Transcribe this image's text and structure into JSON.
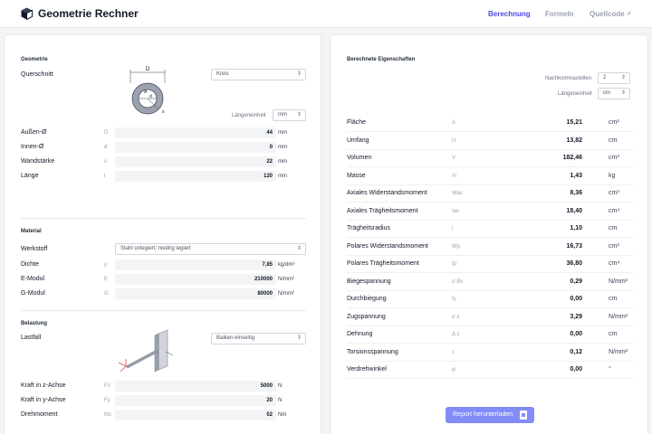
{
  "header": {
    "title": "Geometrie Rechner",
    "nav": {
      "calc": "Berechnung",
      "formulas": "Formeln",
      "source": "Quellcode"
    }
  },
  "geometry": {
    "title": "Geometrie",
    "section_label": "Querschnitt",
    "section_value": "Kreis",
    "diagram_label_top": "D",
    "diagram_label_inner": "d",
    "diagram_label_a": "A",
    "diagram_label_s": "s",
    "unit_label": "Längeneinheit",
    "unit_value": "mm",
    "fields": [
      {
        "label": "Außen-Ø",
        "symbol": "D",
        "value": "44",
        "unit": "mm"
      },
      {
        "label": "Innen-Ø",
        "symbol": "d",
        "value": "0",
        "unit": "mm"
      },
      {
        "label": "Wandstärke",
        "symbol": "s",
        "value": "22",
        "unit": "mm"
      },
      {
        "label": "Länge",
        "symbol": "l",
        "value": "120",
        "unit": "mm"
      }
    ]
  },
  "material": {
    "title": "Material",
    "material_label": "Werkstoff",
    "material_value": "Stahl unlegiert: niedrig legiert",
    "fields": [
      {
        "label": "Dichte",
        "symbol": "ρ",
        "value": "7,85",
        "unit": "kg/dm³"
      },
      {
        "label": "E-Modul",
        "symbol": "E",
        "value": "210000",
        "unit": "N/mm²"
      },
      {
        "label": "G-Modul",
        "symbol": "G",
        "value": "80000",
        "unit": "N/mm²"
      }
    ]
  },
  "load": {
    "title": "Belastung",
    "case_label": "Lastfall",
    "case_value": "Balken einseitig",
    "fields": [
      {
        "label": "Kraft in z-Achse",
        "symbol": "Fz",
        "value": "5000",
        "unit": "N"
      },
      {
        "label": "Kraft in y-Achse",
        "symbol": "Fy",
        "value": "20",
        "unit": "N"
      },
      {
        "label": "Drehmoment",
        "symbol": "Mz",
        "value": "02",
        "unit": "Nm"
      }
    ]
  },
  "results": {
    "title": "Berechnete Eigenschaften",
    "decimals_label": "Nachkommastellen",
    "decimals_value": "2",
    "unit_label": "Längeneinheit",
    "unit_value": "cm",
    "rows": [
      {
        "label": "Fläche",
        "symbol": "A",
        "value": "15,21",
        "unit": "cm²"
      },
      {
        "label": "Umfang",
        "symbol": "U",
        "value": "13,82",
        "unit": "cm"
      },
      {
        "label": "Volumen",
        "symbol": "V",
        "value": "182,46",
        "unit": "cm³"
      },
      {
        "label": "Masse",
        "symbol": "m",
        "value": "1,43",
        "unit": "kg"
      },
      {
        "label": "Axiales Widerstandsmoment",
        "symbol": "Wax",
        "value": "8,36",
        "unit": "cm³"
      },
      {
        "label": "Axiales Trägheitsmoment",
        "symbol": "Iax",
        "value": "18,40",
        "unit": "cm⁴"
      },
      {
        "label": "Trägheitsradius",
        "symbol": "i",
        "value": "1,10",
        "unit": "cm"
      },
      {
        "label": "Polares Widerstandsmoment",
        "symbol": "Wp",
        "value": "16,73",
        "unit": "cm³"
      },
      {
        "label": "Polares Trägheitsmoment",
        "symbol": "Ip",
        "value": "36,80",
        "unit": "cm⁴"
      },
      {
        "label": "Biegespannung",
        "symbol": "σ Bx",
        "value": "0,29",
        "unit": "N/mm²"
      },
      {
        "label": "Durchbiegung",
        "symbol": "fy",
        "value": "0,00",
        "unit": "cm"
      },
      {
        "label": "Zugspannung",
        "symbol": "σ z",
        "value": "3,29",
        "unit": "N/mm²"
      },
      {
        "label": "Dehnung",
        "symbol": "Δ z",
        "value": "0,00",
        "unit": "cm"
      },
      {
        "label": "Torsionsspannung",
        "symbol": "τ",
        "value": "0,12",
        "unit": "N/mm²"
      },
      {
        "label": "Verdrehwinkel",
        "symbol": "φ",
        "value": "0,00",
        "unit": "°"
      }
    ],
    "button_label": "Report herunterladen"
  }
}
